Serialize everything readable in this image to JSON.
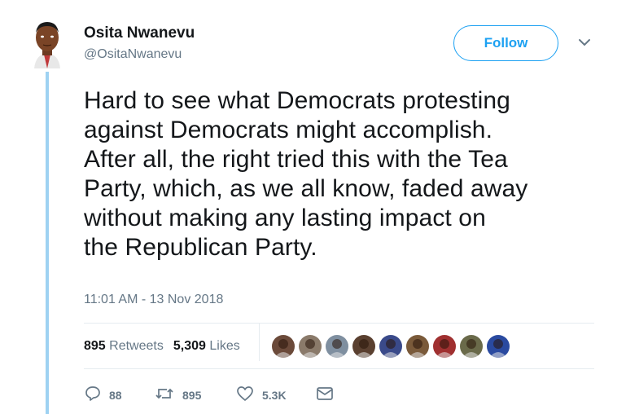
{
  "author": {
    "name": "Osita Nwanevu",
    "handle": "@OsitaNwanevu"
  },
  "follow_label": "Follow",
  "tweet_lines": [
    "Hard to see what Democrats protesting",
    "against Democrats might accomplish.",
    "After all, the right tried this with the Tea",
    "Party, which, as we all know, faded away",
    "without making any lasting impact on",
    "the Republican Party."
  ],
  "timestamp": "11:01 AM - 13 Nov 2018",
  "stats": {
    "retweets_count": "895",
    "retweets_label": "Retweets",
    "likes_count": "5,309",
    "likes_label": "Likes"
  },
  "liker_avatar_colors": [
    "#6b4a3a",
    "#8a7a6a",
    "#7f8fa0",
    "#5a4030",
    "#3a4a8a",
    "#7a5a3a",
    "#a03030",
    "#6a6a4a",
    "#2a4aa0"
  ],
  "actions": {
    "replies": "88",
    "retweets": "895",
    "likes": "5.3K"
  },
  "colors": {
    "accent": "#1da1f2",
    "muted": "#657786",
    "thread": "#9ed2f2"
  }
}
